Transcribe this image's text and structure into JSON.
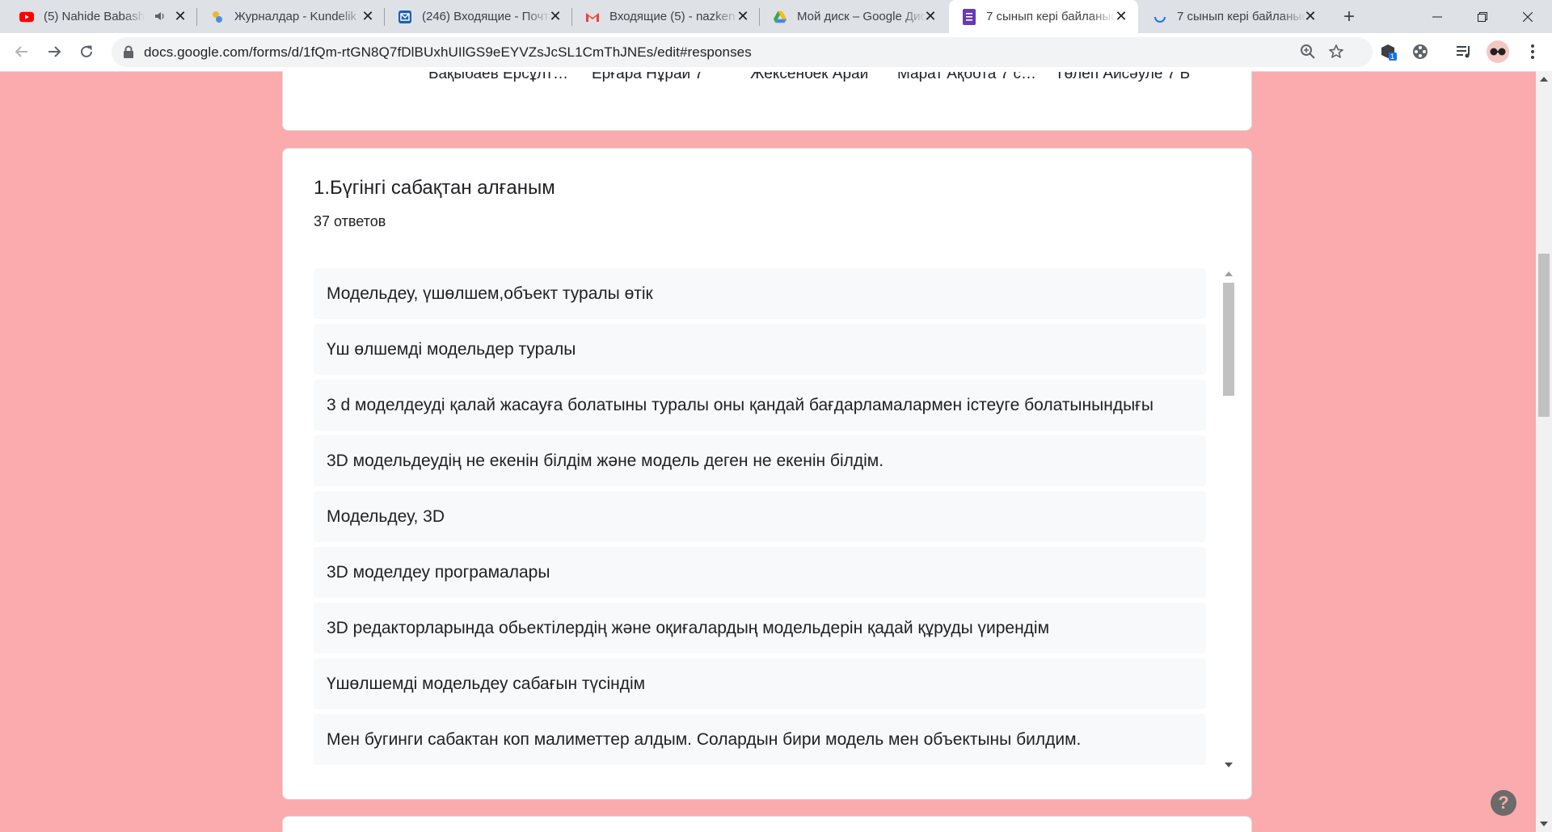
{
  "browser": {
    "tabs": [
      {
        "title": "(5) Nahide Babashli",
        "icon": "youtube-icon",
        "audio": "speaker-icon"
      },
      {
        "title": "Журналдар - Kundelik",
        "icon": "kundelik-icon"
      },
      {
        "title": "(246) Входящие - Почта",
        "icon": "mail-icon"
      },
      {
        "title": "Входящие (5) - nazken",
        "icon": "gmail-icon"
      },
      {
        "title": "Мой диск – Google Диск",
        "icon": "drive-icon"
      },
      {
        "title": "7 сынып кері байланыс",
        "icon": "forms-icon",
        "active": true
      },
      {
        "title": "7 сынып кері байланыс",
        "icon": "loading-icon"
      }
    ],
    "url": "docs.google.com/forms/d/1fQm-rtGN8Q7fDlBUxhUIlGS9eEYVZsJcSL1CmThJNEs/edit#responses",
    "extension_badge": "1"
  },
  "prev_card": {
    "names": [
      "Бақыбаев Ерсұлт…",
      "Ерғара Нұрай 7",
      "Жексенбек Арай",
      "Марат Ақбота 7 с…",
      "Төлеп Айсәуле 7 Б"
    ]
  },
  "question": {
    "title": "1.Бүгінгі сабақтан алғаным",
    "count": "37 ответов",
    "responses": [
      "Модельдеу, үшөлшем,объект туралы өтік",
      "Үш өлшемді модельдер туралы",
      "3 d моделдеуді қалай жасауға болатыны туралы оны қандай бағдарламалармен істеуге болатынындығы",
      "3D модельдеудің не екенін білдім және модель деген не екенін білдім.",
      "Модельдеу, 3D",
      "3D моделдеу програмалары",
      "3D редакторларында обьектілердің және оқиғалардың модельдерін қадай құруды үирендім",
      "Үшөлшемді модельдеу сабағын түсіндім",
      "Мен бугинги сабактан коп малиметтер алдым. Солардын бири модель мен объектыны билдим."
    ]
  },
  "help": {
    "label": "?"
  },
  "colors": {
    "page_bg": "#fbabad",
    "card_bg": "#ffffff",
    "item_bg": "#f8f9fa",
    "tabstrip": "#dee1e6"
  }
}
